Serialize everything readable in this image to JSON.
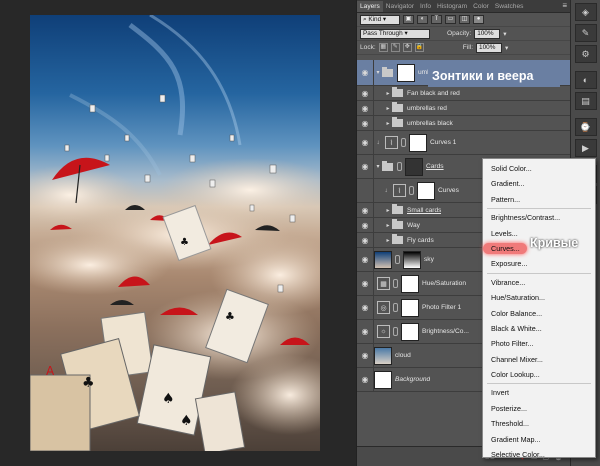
{
  "panel": {
    "tabs": [
      {
        "label": "Layers",
        "active": true
      },
      {
        "label": "Navigator",
        "active": false
      },
      {
        "label": "Info",
        "active": false
      },
      {
        "label": "Histogram",
        "active": false
      },
      {
        "label": "Color",
        "active": false
      },
      {
        "label": "Swatches",
        "active": false
      }
    ],
    "filter_kind": "Kind",
    "blend_mode": "Pass Through",
    "opacity_label": "Opacity:",
    "opacity_value": "100%",
    "lock_label": "Lock:",
    "fill_label": "Fill:",
    "fill_value": "100%"
  },
  "layers": [
    {
      "name": "umb...",
      "type": "group-selected"
    },
    {
      "name": "Fan black and red",
      "type": "group"
    },
    {
      "name": "umbrellas red",
      "type": "group"
    },
    {
      "name": "umbrellas black",
      "type": "group"
    },
    {
      "name": "Curves 1",
      "type": "adjustment"
    },
    {
      "name": "Cards",
      "type": "group-open"
    },
    {
      "name": "Curves",
      "type": "adjustment-child"
    },
    {
      "name": "Small cards",
      "type": "group"
    },
    {
      "name": "Way",
      "type": "group"
    },
    {
      "name": "Fly cards",
      "type": "group"
    },
    {
      "name": "sky",
      "type": "image"
    },
    {
      "name": "Hue/Saturation",
      "type": "adjustment"
    },
    {
      "name": "Photo Filter 1",
      "type": "adjustment"
    },
    {
      "name": "Brightness/Co...",
      "type": "adjustment"
    },
    {
      "name": "cloud",
      "type": "image"
    },
    {
      "name": "Background",
      "type": "background"
    }
  ],
  "callouts": {
    "group_title": "Зонтики и веера",
    "curves_title": "Кривые"
  },
  "menu": {
    "groups": [
      [
        "Solid Color...",
        "Gradient...",
        "Pattern..."
      ],
      [
        "Brightness/Contrast...",
        "Levels...",
        "Curves...",
        "Exposure..."
      ],
      [
        "Vibrance...",
        "Hue/Saturation...",
        "Color Balance...",
        "Black & White...",
        "Photo Filter...",
        "Channel Mixer...",
        "Color Lookup..."
      ],
      [
        "Invert",
        "Posterize...",
        "Threshold...",
        "Gradient Map...",
        "Selective Color..."
      ]
    ],
    "highlighted": "Curves..."
  },
  "footer": {
    "fx_label": "fx"
  },
  "colors": {
    "selection": "#6a7fa2",
    "panel": "#535353",
    "highlight_pill": "#f07a7a"
  }
}
